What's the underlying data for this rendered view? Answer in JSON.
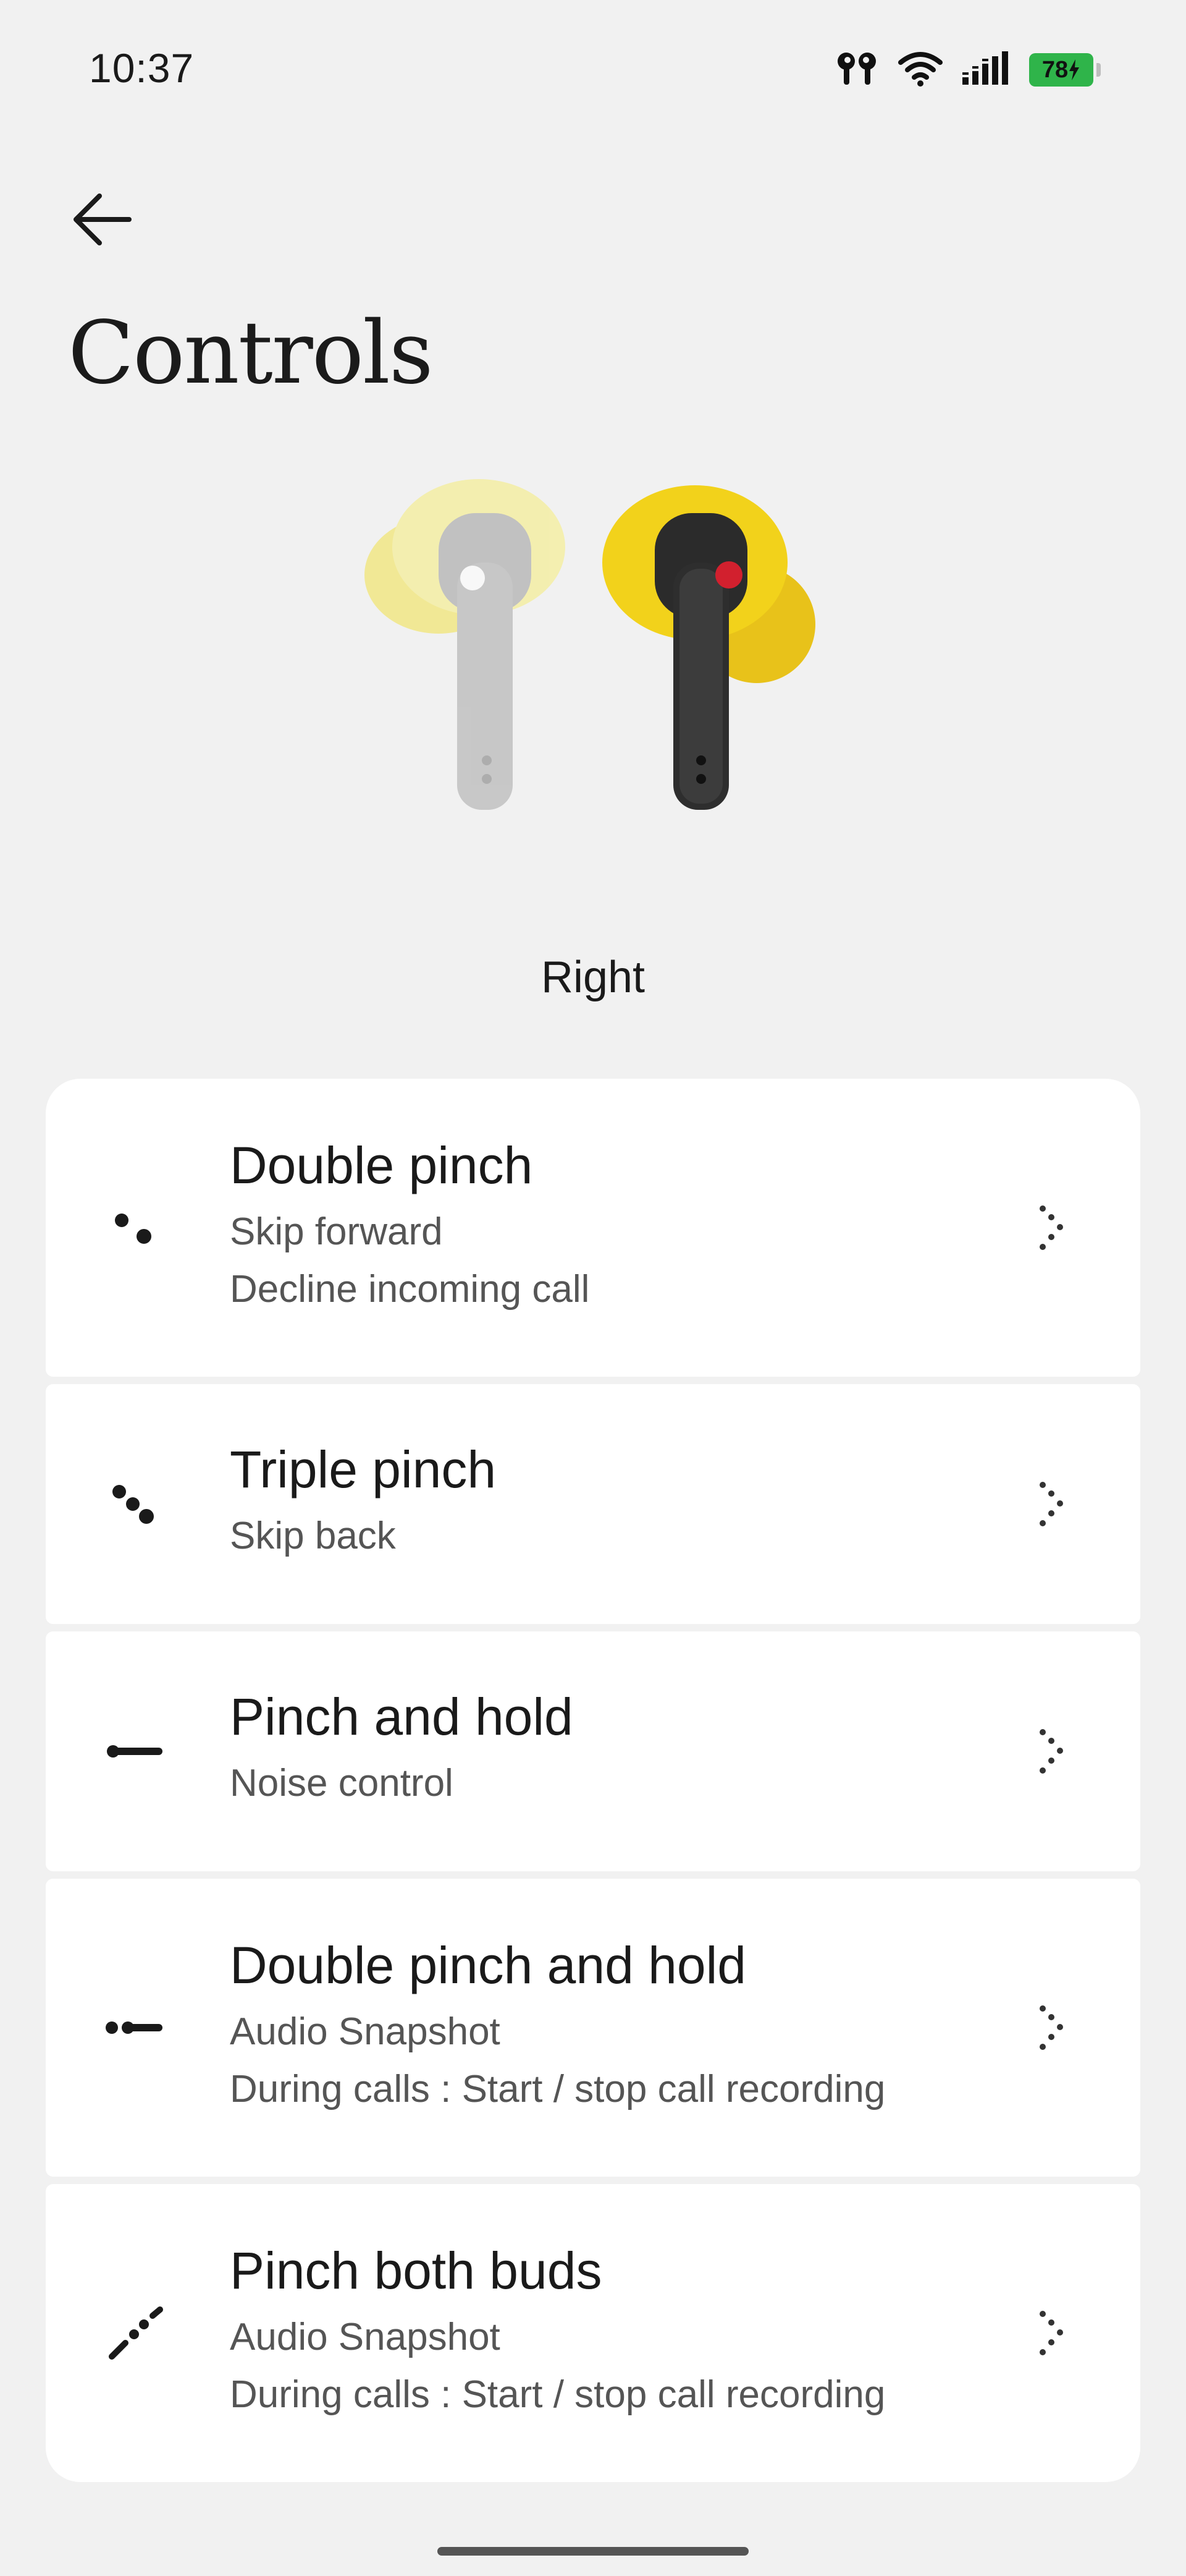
{
  "status_bar": {
    "time": "10:37",
    "battery_level": "78",
    "icons": [
      "earbuds-icon",
      "wifi-icon",
      "signal-icon",
      "battery-icon"
    ]
  },
  "header": {
    "title": "Controls"
  },
  "device": {
    "image": "earbuds-image",
    "side_label": "Right"
  },
  "controls": [
    {
      "icon": "double-pinch-icon",
      "title": "Double pinch",
      "descriptions": [
        "Skip forward",
        "Decline incoming call"
      ]
    },
    {
      "icon": "triple-pinch-icon",
      "title": "Triple pinch",
      "descriptions": [
        "Skip back"
      ]
    },
    {
      "icon": "pinch-hold-icon",
      "title": "Pinch and hold",
      "descriptions": [
        "Noise control"
      ]
    },
    {
      "icon": "double-pinch-hold-icon",
      "title": "Double pinch and hold",
      "descriptions": [
        "Audio Snapshot",
        "During calls : Start / stop call recording"
      ]
    },
    {
      "icon": "pinch-both-icon",
      "title": "Pinch both buds",
      "descriptions": [
        "Audio Snapshot",
        "During calls : Start / stop call recording"
      ]
    }
  ],
  "colors": {
    "background": "#f1f1f1",
    "card": "#ffffff",
    "battery": "#2fb44a",
    "earbud_accent": "#f2d21b",
    "earbud_red": "#d2202e"
  }
}
